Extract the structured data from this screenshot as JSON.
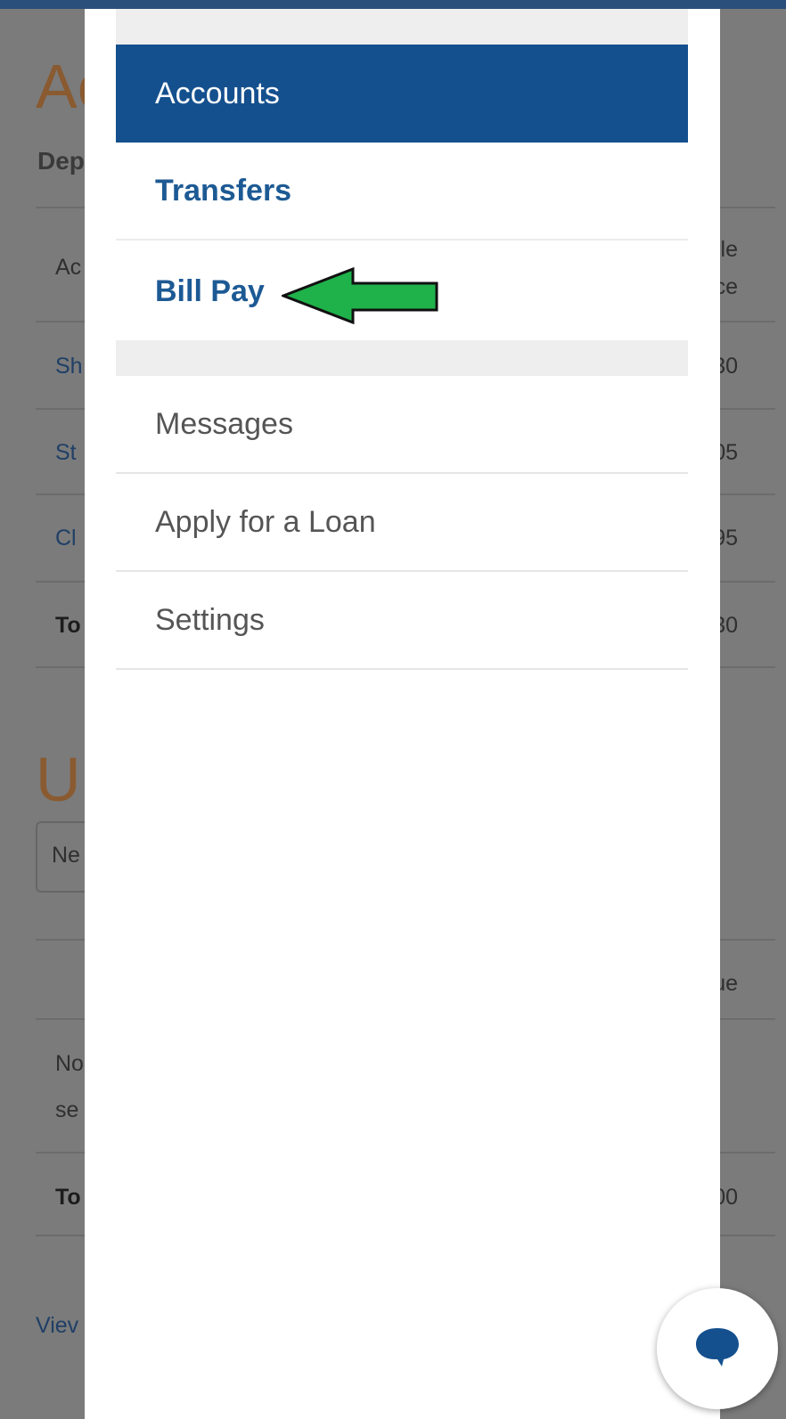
{
  "background": {
    "heading_fragment": "Ac",
    "sub_fragment": "Dep",
    "col_header_left": "Ac",
    "col_header_right_1": "ble",
    "col_header_right_2": "ce",
    "rows_left": [
      "Sh",
      "St",
      "Cl"
    ],
    "rows_right": [
      "30",
      "05",
      "95"
    ],
    "total_left": "To",
    "total_right": "30",
    "heading2_fragment": "U",
    "input_fragment": "Ne",
    "col2_header_right": "ue",
    "note_line1": "No",
    "note_line2": "se",
    "total2_left": "To",
    "total2_right": "00",
    "view_fragment": "Viev"
  },
  "drawer": {
    "items": [
      {
        "label": "Accounts",
        "state": "active"
      },
      {
        "label": "Transfers",
        "state": "primary"
      },
      {
        "label": "Bill Pay",
        "state": "primary"
      },
      {
        "label": "Messages",
        "state": "secondary"
      },
      {
        "label": "Apply for a Loan",
        "state": "secondary"
      },
      {
        "label": "Settings",
        "state": "secondary"
      }
    ]
  },
  "annotation": {
    "icon": "green-arrow-icon",
    "color": "#1fb14a"
  },
  "chat": {
    "icon": "chat-bubble-icon",
    "color": "#15508e"
  },
  "colors": {
    "brand": "#15508e",
    "link": "#1d5a94"
  }
}
